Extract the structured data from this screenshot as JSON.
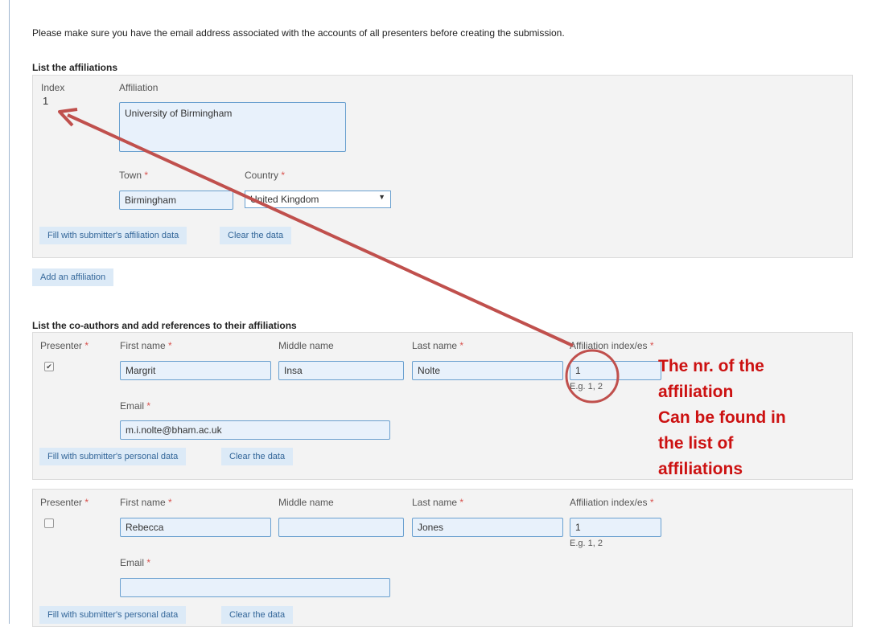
{
  "intro_text": "Please make sure you have the email address associated with the accounts of all presenters before creating the submission.",
  "affiliations": {
    "title": "List the affiliations",
    "index_label": "Index",
    "affiliation_label": "Affiliation",
    "index_value": "1",
    "affiliation_value": "University of Birmingham",
    "town_label": "Town",
    "town_value": "Birmingham",
    "country_label": "Country",
    "country_value": "United Kingdom",
    "fill_button": "Fill with submitter's affiliation data",
    "clear_button": "Clear the data",
    "add_button": "Add an affiliation"
  },
  "coauthors": {
    "title": "List the co-authors and add references to their affiliations",
    "labels": {
      "presenter": "Presenter",
      "first_name": "First name",
      "middle_name": "Middle name",
      "last_name": "Last name",
      "affiliation_index": "Affiliation index/es",
      "email": "Email",
      "affiliation_hint": "E.g. 1, 2",
      "required_marker": "*"
    },
    "authors": [
      {
        "presenter_checked": true,
        "first_name": "Margrit",
        "middle_name": "Insa",
        "last_name": "Nolte",
        "affiliation_index": "1",
        "email": "m.i.nolte@bham.ac.uk"
      },
      {
        "presenter_checked": false,
        "first_name": "Rebecca",
        "middle_name": "",
        "last_name": "Jones",
        "affiliation_index": "1",
        "email": ""
      }
    ],
    "fill_button": "Fill with submitter's personal data",
    "clear_button": "Clear the data"
  },
  "annotation": {
    "lines": [
      "The nr. of the",
      "affiliation",
      "Can be found in",
      "the list of",
      "affiliations"
    ],
    "color": "#cc1111",
    "arrow_color": "#c0504d"
  }
}
